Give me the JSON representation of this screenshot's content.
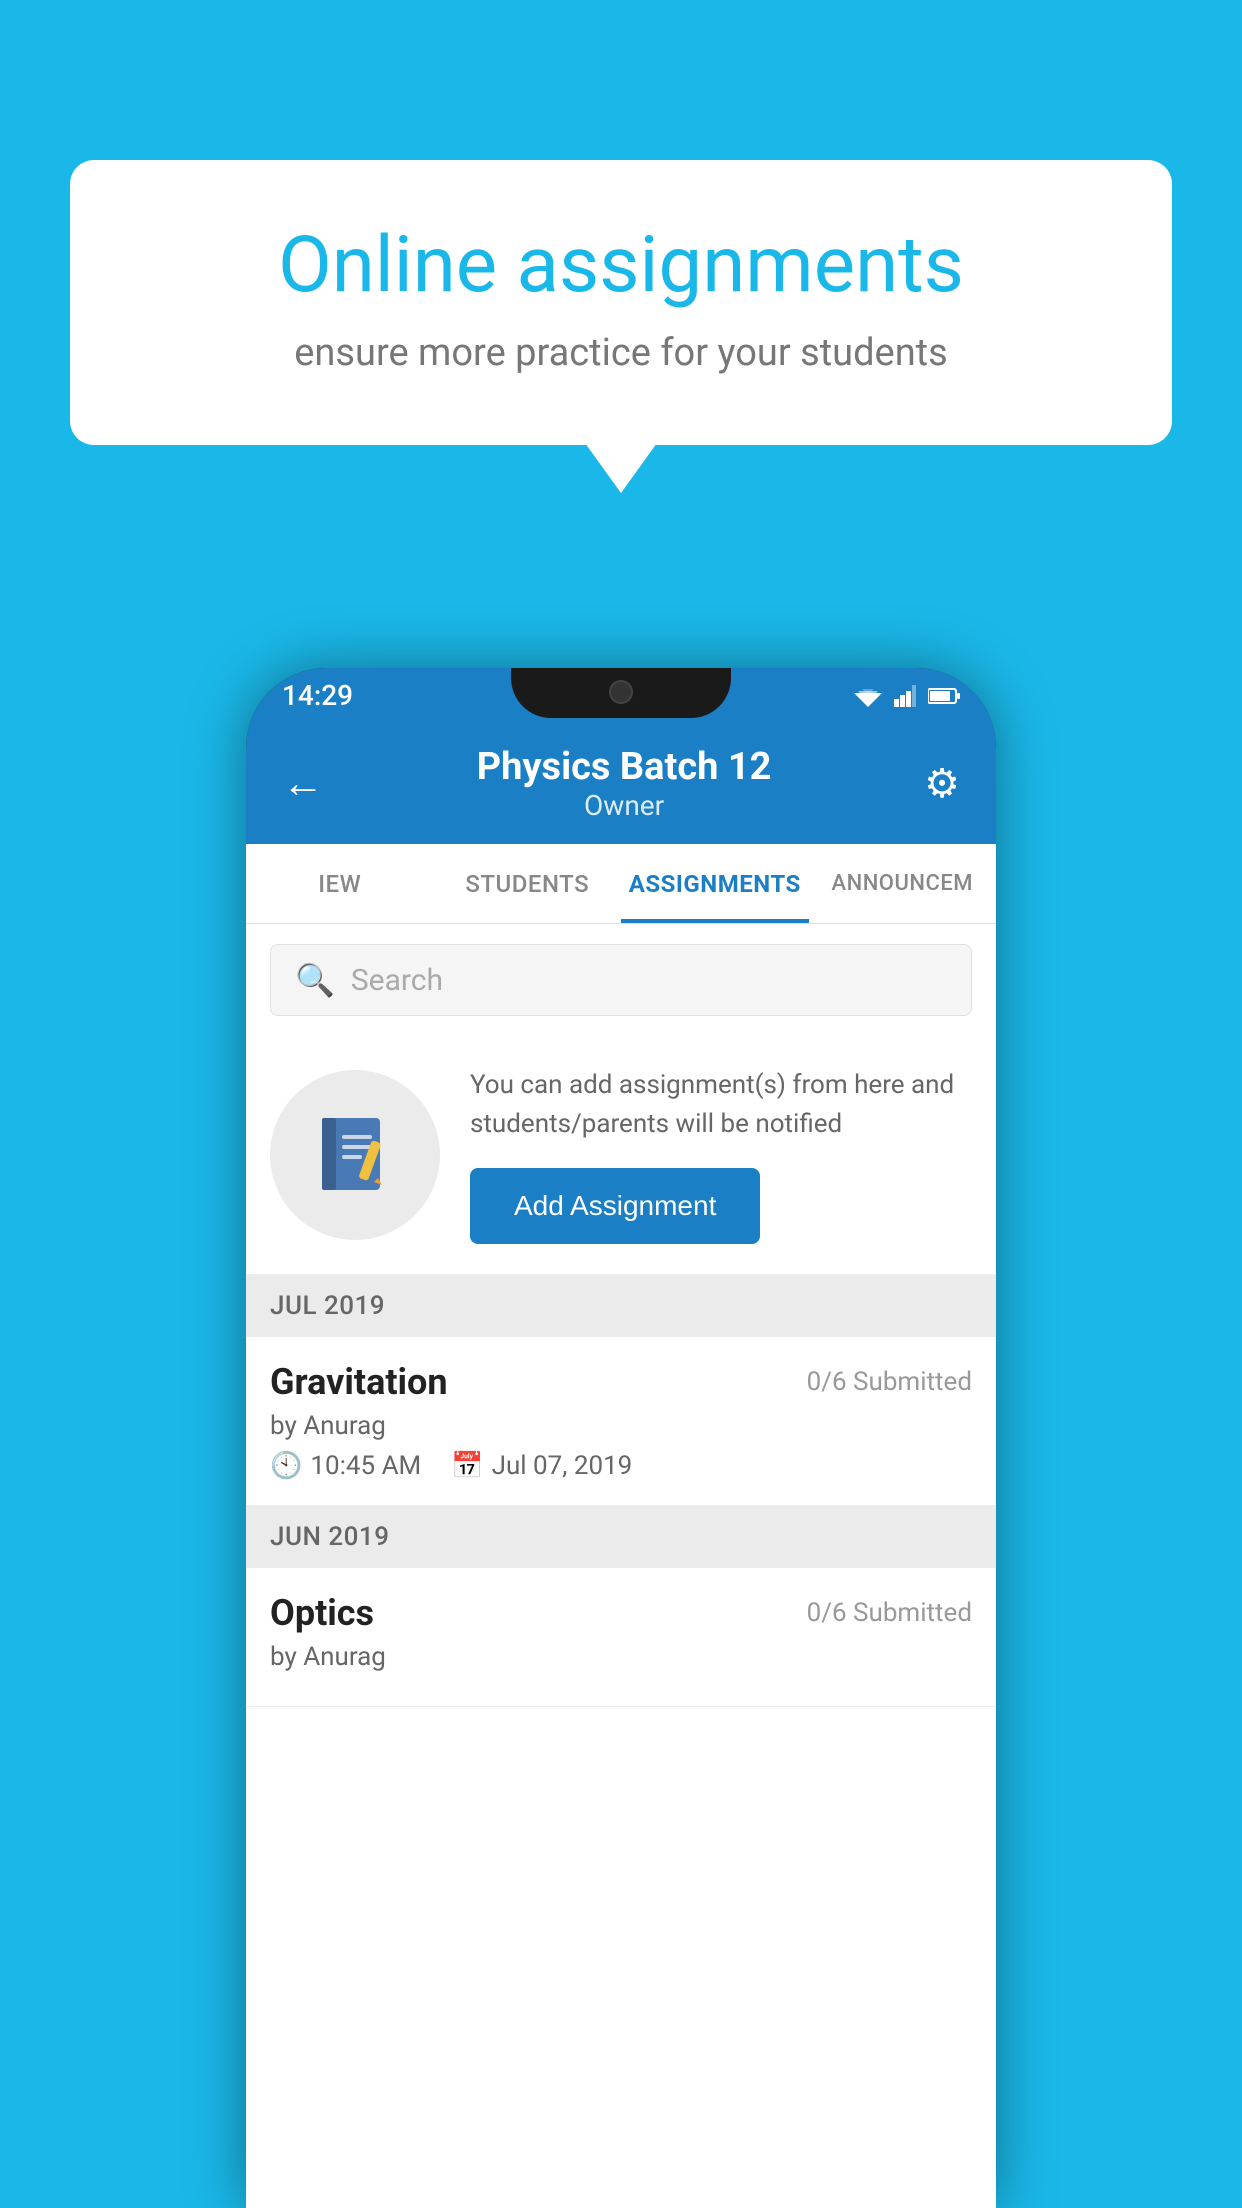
{
  "background_color": "#1ab8e8",
  "speech_bubble": {
    "title": "Online assignments",
    "subtitle": "ensure more practice for your students"
  },
  "phone": {
    "status_bar": {
      "time": "14:29"
    },
    "header": {
      "title": "Physics Batch 12",
      "subtitle": "Owner",
      "back_label": "←",
      "gear_label": "⚙"
    },
    "tabs": [
      {
        "label": "IEW",
        "active": false
      },
      {
        "label": "STUDENTS",
        "active": false
      },
      {
        "label": "ASSIGNMENTS",
        "active": true
      },
      {
        "label": "ANNOUNCEM...",
        "active": false
      }
    ],
    "search": {
      "placeholder": "Search"
    },
    "empty_state": {
      "description": "You can add assignment(s) from here and students/parents will be notified",
      "button_label": "Add Assignment"
    },
    "sections": [
      {
        "month": "JUL 2019",
        "assignments": [
          {
            "title": "Gravitation",
            "submitted": "0/6 Submitted",
            "author": "by Anurag",
            "time": "10:45 AM",
            "date": "Jul 07, 2019"
          }
        ]
      },
      {
        "month": "JUN 2019",
        "assignments": [
          {
            "title": "Optics",
            "submitted": "0/6 Submitted",
            "author": "by Anurag",
            "time": "",
            "date": ""
          }
        ]
      }
    ]
  }
}
